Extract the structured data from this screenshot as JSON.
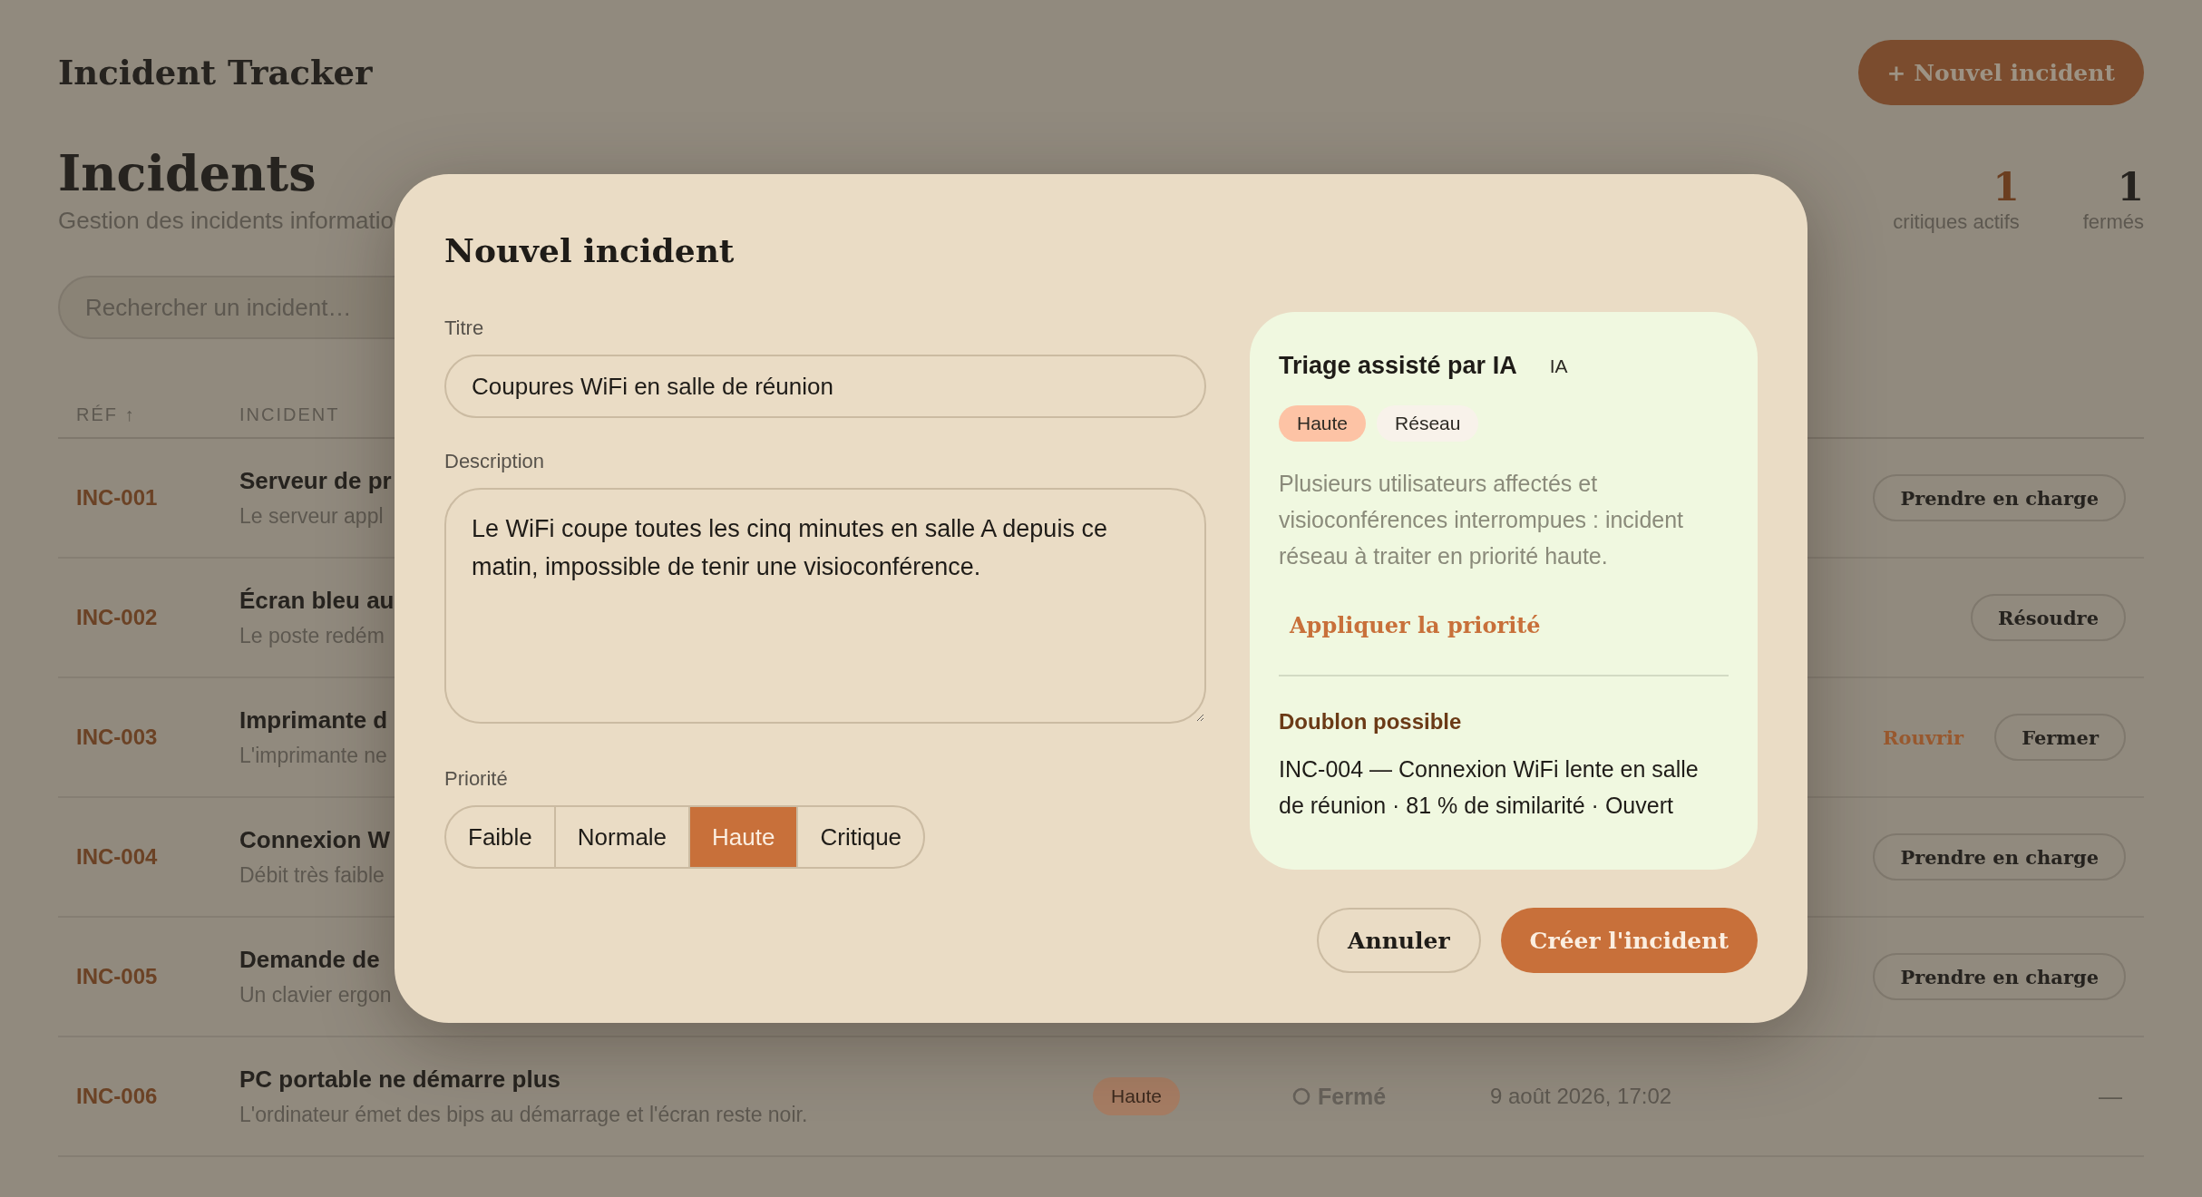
{
  "app": {
    "title": "Incident Tracker",
    "new_button": "+ Nouvel incident"
  },
  "page": {
    "title": "Incidents",
    "subtitle": "Gestion des incidents informatio"
  },
  "stats": [
    {
      "value": "1",
      "label": "critiques actifs",
      "kind": "critical"
    },
    {
      "value": "1",
      "label": "fermés",
      "kind": "plain"
    }
  ],
  "search": {
    "placeholder": "Rechercher un incident…"
  },
  "table": {
    "columns": [
      {
        "label": "RÉF ↑"
      },
      {
        "label": "INCIDENT"
      }
    ],
    "rows": [
      {
        "ref": "INC-001",
        "title": "Serveur de pr",
        "description": "Le serveur appl",
        "actions": [
          {
            "label": "Prendre en charge",
            "kind": "button"
          }
        ]
      },
      {
        "ref": "INC-002",
        "title": "Écran bleu au",
        "description": "Le poste redém",
        "actions": [
          {
            "label": "Résoudre",
            "kind": "button"
          }
        ]
      },
      {
        "ref": "INC-003",
        "title": "Imprimante d",
        "description": "L'imprimante ne",
        "actions": [
          {
            "label": "Rouvrir",
            "kind": "link"
          },
          {
            "label": "Fermer",
            "kind": "button"
          }
        ]
      },
      {
        "ref": "INC-004",
        "title": "Connexion W",
        "description": "Débit très faible",
        "actions": [
          {
            "label": "Prendre en charge",
            "kind": "button"
          }
        ]
      },
      {
        "ref": "INC-005",
        "title": "Demande de",
        "description": "Un clavier ergon",
        "actions": [
          {
            "label": "Prendre en charge",
            "kind": "button"
          }
        ]
      },
      {
        "ref": "INC-006",
        "title": "PC portable ne démarre plus",
        "description": "L'ordinateur émet des bips au démarrage et l'écran reste noir.",
        "priority": "Haute",
        "status": "Fermé",
        "date": "9 août 2026, 17:02",
        "actions": [
          {
            "label": "—",
            "kind": "none"
          }
        ]
      }
    ]
  },
  "modal": {
    "title": "Nouvel incident",
    "fields": [
      {
        "label": "Titre",
        "kind": "input",
        "value": "Coupures WiFi en salle de réunion"
      },
      {
        "label": "Description",
        "kind": "textarea",
        "value": "Le WiFi coupe toutes les cinq minutes en salle A depuis ce matin, impossible de tenir une visioconférence."
      }
    ],
    "priority": {
      "label": "Priorité",
      "options": [
        {
          "label": "Faible",
          "selected": false
        },
        {
          "label": "Normale",
          "selected": false
        },
        {
          "label": "Haute",
          "selected": true
        },
        {
          "label": "Critique",
          "selected": false
        }
      ]
    },
    "triage": {
      "title": "Triage assisté par IA",
      "badge": "IA",
      "tags": [
        {
          "label": "Haute",
          "color": "#fdc3a5"
        },
        {
          "label": "Réseau",
          "color": "#f8f2ea"
        }
      ],
      "summary": "Plusieurs utilisateurs affectés et visioconférences interrompues : incident réseau à traiter en priorité haute.",
      "apply_link": "Appliquer la priorité",
      "duplicate": {
        "title": "Doublon possible",
        "text": "INC-004 — Connexion WiFi lente en salle de réunion · 81 % de similarité · Ouvert"
      }
    },
    "buttons": [
      {
        "label": "Annuler",
        "kind": "secondary"
      },
      {
        "label": "Créer l'incident",
        "kind": "primary"
      }
    ]
  }
}
